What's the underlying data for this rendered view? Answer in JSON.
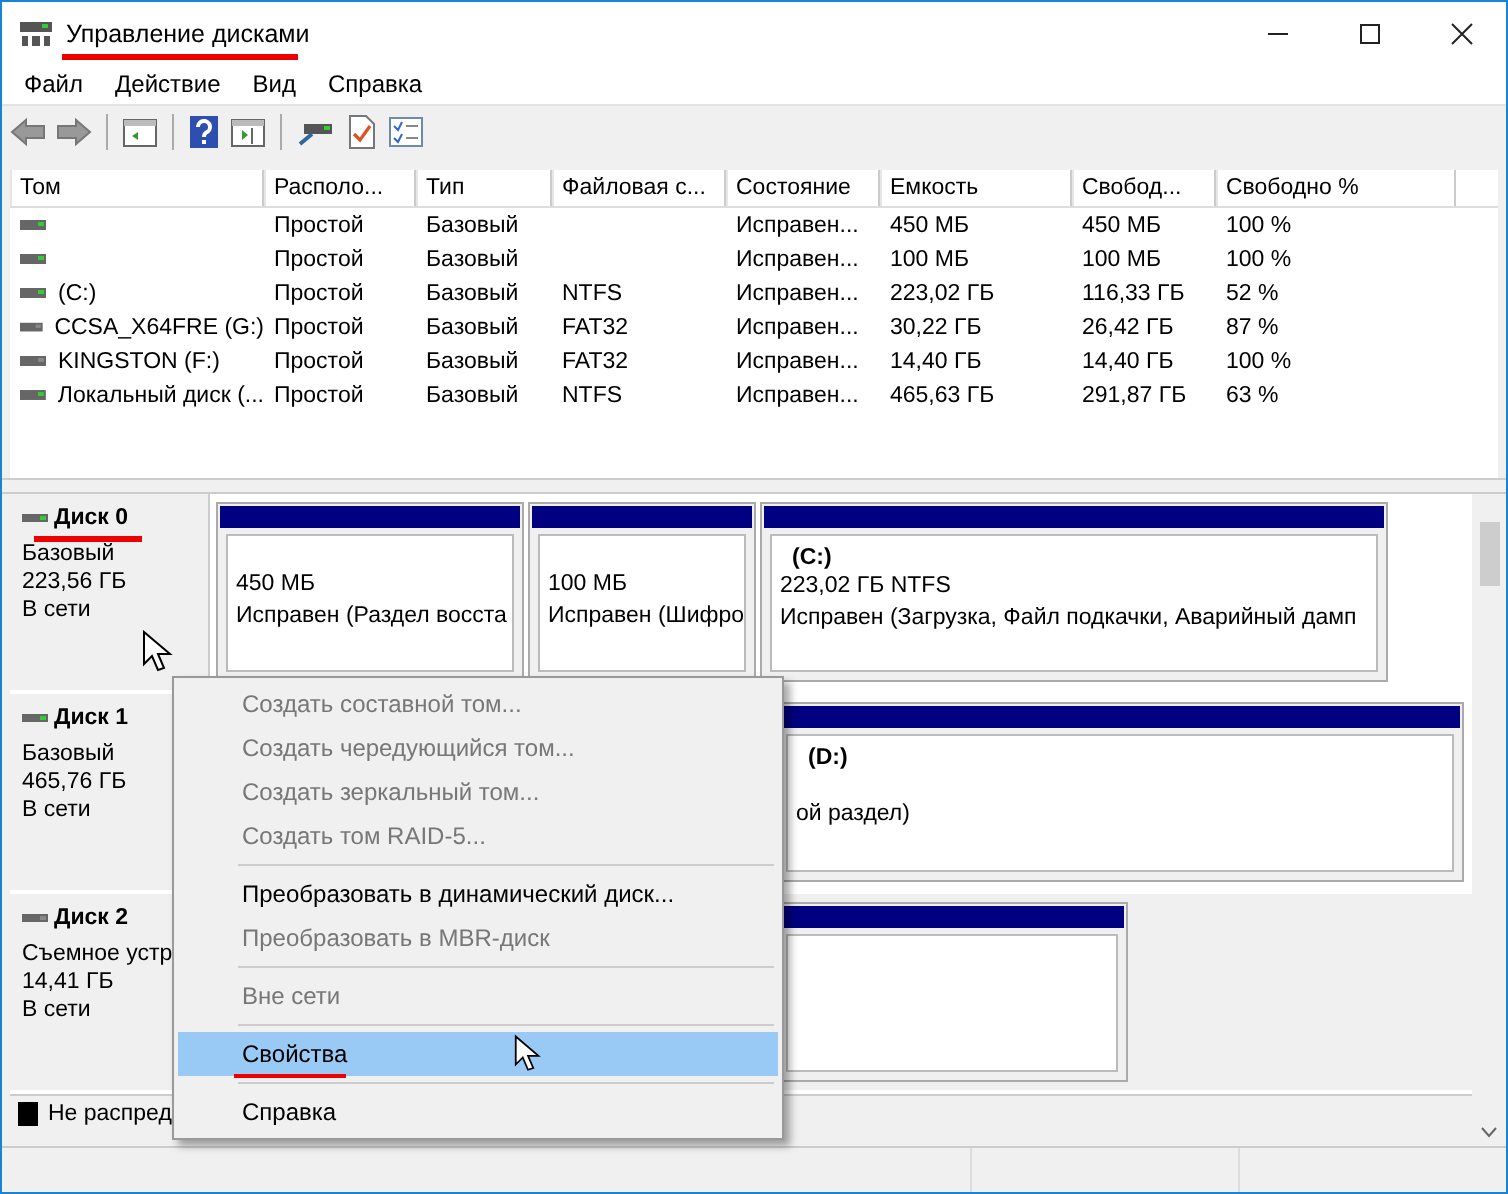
{
  "window": {
    "title": "Управление дисками"
  },
  "menu": [
    "Файл",
    "Действие",
    "Вид",
    "Справка"
  ],
  "table": {
    "columns": [
      "Том",
      "Располо...",
      "Тип",
      "Файловая с...",
      "Состояние",
      "Емкость",
      "Свобод...",
      "Свободно %"
    ],
    "rows": [
      [
        "",
        "Простой",
        "Базовый",
        "",
        "Исправен...",
        "450 МБ",
        "450 МБ",
        "100 %"
      ],
      [
        "",
        "Простой",
        "Базовый",
        "",
        "Исправен...",
        "100 МБ",
        "100 МБ",
        "100 %"
      ],
      [
        "(C:)",
        "Простой",
        "Базовый",
        "NTFS",
        "Исправен...",
        "223,02 ГБ",
        "116,33 ГБ",
        "52 %"
      ],
      [
        "CCSA_X64FRE (G:)",
        "Простой",
        "Базовый",
        "FAT32",
        "Исправен...",
        "30,22 ГБ",
        "26,42 ГБ",
        "87 %"
      ],
      [
        "KINGSTON (F:)",
        "Простой",
        "Базовый",
        "FAT32",
        "Исправен...",
        "14,40 ГБ",
        "14,40 ГБ",
        "100 %"
      ],
      [
        "Локальный диск (...",
        "Простой",
        "Базовый",
        "NTFS",
        "Исправен...",
        "465,63 ГБ",
        "291,87 ГБ",
        "63 %"
      ]
    ]
  },
  "disks": [
    {
      "name": "Диск 0",
      "type": "Базовый",
      "size": "223,56 ГБ",
      "status": "В сети",
      "partitions": [
        {
          "color": "#000080",
          "lines": [
            "450 МБ",
            "Исправен (Раздел восста"
          ]
        },
        {
          "color": "#000080",
          "lines": [
            "100 МБ",
            "Исправен (Шифро"
          ]
        },
        {
          "color": "#000080",
          "title": "(C:)",
          "lines": [
            "223,02 ГБ NTFS",
            "Исправен (Загрузка, Файл подкачки, Аварийный дамп"
          ]
        }
      ]
    },
    {
      "name": "Диск 1",
      "type": "Базовый",
      "size": "465,76 ГБ",
      "status": "В сети",
      "partitions": [
        {
          "color": "#000080",
          "title": "(D:)",
          "lines": [
            "ой раздел)"
          ]
        }
      ]
    },
    {
      "name": "Диск 2",
      "type": "Съемное устр",
      "size": "14,41 ГБ",
      "status": "В сети",
      "partitions": [
        {
          "color": "#000080"
        }
      ]
    }
  ],
  "legend": [
    {
      "label": "Не распред",
      "color": "#000000"
    }
  ],
  "context_menu": [
    {
      "kind": "item",
      "label": "Создать составной том...",
      "disabled": true,
      "selected": false
    },
    {
      "kind": "item",
      "label": "Создать чередующийся том...",
      "disabled": true,
      "selected": false
    },
    {
      "kind": "item",
      "label": "Создать зеркальный том...",
      "disabled": true,
      "selected": false
    },
    {
      "kind": "item",
      "label": "Создать том RAID-5...",
      "disabled": true,
      "selected": false
    },
    {
      "kind": "separator"
    },
    {
      "kind": "item",
      "label": "Преобразовать в динамический диск...",
      "disabled": false,
      "selected": false
    },
    {
      "kind": "item",
      "label": "Преобразовать в MBR-диск",
      "disabled": true,
      "selected": false
    },
    {
      "kind": "separator"
    },
    {
      "kind": "item",
      "label": "Вне сети",
      "disabled": true,
      "selected": false
    },
    {
      "kind": "separator"
    },
    {
      "kind": "item",
      "label": "Свойства",
      "disabled": false,
      "selected": true
    },
    {
      "kind": "separator"
    },
    {
      "kind": "item",
      "label": "Справка",
      "disabled": false,
      "selected": false
    }
  ]
}
